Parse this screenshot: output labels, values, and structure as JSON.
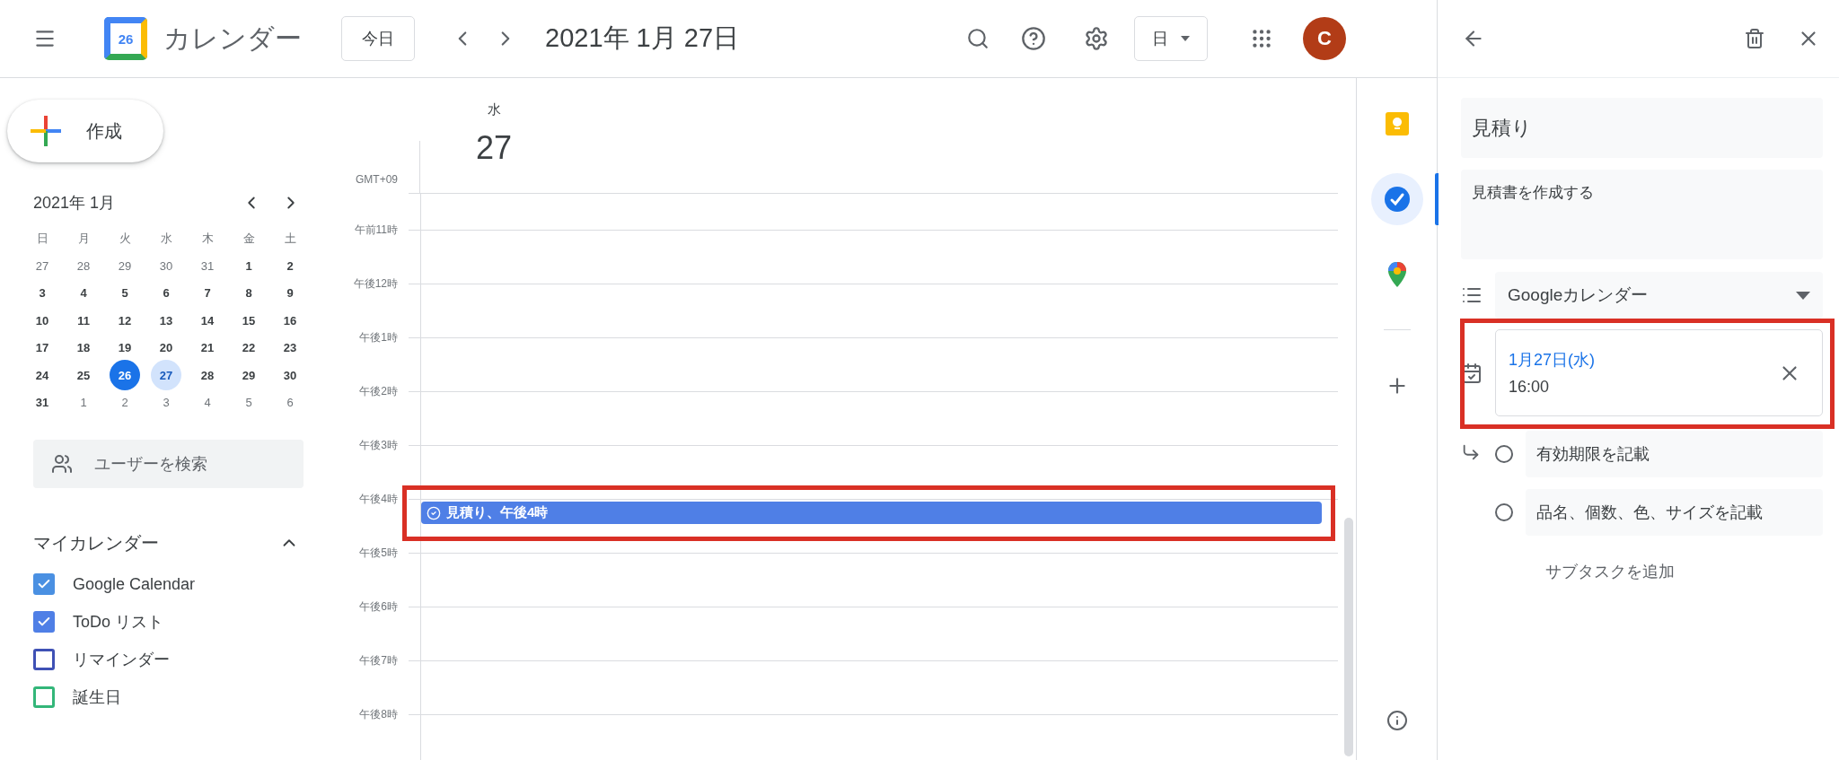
{
  "header": {
    "app_title": "カレンダー",
    "logo_day": "26",
    "today_button": "今日",
    "date_title": "2021年 1月 27日",
    "view_select": "日",
    "avatar": "C"
  },
  "create_button": "作成",
  "mini_calendar": {
    "title": "2021年 1月",
    "weekdays": [
      "日",
      "月",
      "火",
      "水",
      "木",
      "金",
      "土"
    ],
    "weeks": [
      [
        {
          "day": "27",
          "muted": true,
          "today": false,
          "selected": false
        },
        {
          "day": "28",
          "muted": true,
          "today": false,
          "selected": false
        },
        {
          "day": "29",
          "muted": true,
          "today": false,
          "selected": false
        },
        {
          "day": "30",
          "muted": true,
          "today": false,
          "selected": false
        },
        {
          "day": "31",
          "muted": true,
          "today": false,
          "selected": false
        },
        {
          "day": "1",
          "muted": false,
          "today": false,
          "selected": false
        },
        {
          "day": "2",
          "muted": false,
          "today": false,
          "selected": false
        }
      ],
      [
        {
          "day": "3",
          "muted": false,
          "today": false,
          "selected": false
        },
        {
          "day": "4",
          "muted": false,
          "today": false,
          "selected": false
        },
        {
          "day": "5",
          "muted": false,
          "today": false,
          "selected": false
        },
        {
          "day": "6",
          "muted": false,
          "today": false,
          "selected": false
        },
        {
          "day": "7",
          "muted": false,
          "today": false,
          "selected": false
        },
        {
          "day": "8",
          "muted": false,
          "today": false,
          "selected": false
        },
        {
          "day": "9",
          "muted": false,
          "today": false,
          "selected": false
        }
      ],
      [
        {
          "day": "10",
          "muted": false,
          "today": false,
          "selected": false
        },
        {
          "day": "11",
          "muted": false,
          "today": false,
          "selected": false
        },
        {
          "day": "12",
          "muted": false,
          "today": false,
          "selected": false
        },
        {
          "day": "13",
          "muted": false,
          "today": false,
          "selected": false
        },
        {
          "day": "14",
          "muted": false,
          "today": false,
          "selected": false
        },
        {
          "day": "15",
          "muted": false,
          "today": false,
          "selected": false
        },
        {
          "day": "16",
          "muted": false,
          "today": false,
          "selected": false
        }
      ],
      [
        {
          "day": "17",
          "muted": false,
          "today": false,
          "selected": false
        },
        {
          "day": "18",
          "muted": false,
          "today": false,
          "selected": false
        },
        {
          "day": "19",
          "muted": false,
          "today": false,
          "selected": false
        },
        {
          "day": "20",
          "muted": false,
          "today": false,
          "selected": false
        },
        {
          "day": "21",
          "muted": false,
          "today": false,
          "selected": false
        },
        {
          "day": "22",
          "muted": false,
          "today": false,
          "selected": false
        },
        {
          "day": "23",
          "muted": false,
          "today": false,
          "selected": false
        }
      ],
      [
        {
          "day": "24",
          "muted": false,
          "today": false,
          "selected": false
        },
        {
          "day": "25",
          "muted": false,
          "today": false,
          "selected": false
        },
        {
          "day": "26",
          "muted": false,
          "today": true,
          "selected": false
        },
        {
          "day": "27",
          "muted": false,
          "today": false,
          "selected": true
        },
        {
          "day": "28",
          "muted": false,
          "today": false,
          "selected": false
        },
        {
          "day": "29",
          "muted": false,
          "today": false,
          "selected": false
        },
        {
          "day": "30",
          "muted": false,
          "today": false,
          "selected": false
        }
      ],
      [
        {
          "day": "31",
          "muted": false,
          "today": false,
          "selected": false
        },
        {
          "day": "1",
          "muted": true,
          "today": false,
          "selected": false
        },
        {
          "day": "2",
          "muted": true,
          "today": false,
          "selected": false
        },
        {
          "day": "3",
          "muted": true,
          "today": false,
          "selected": false
        },
        {
          "day": "4",
          "muted": true,
          "today": false,
          "selected": false
        },
        {
          "day": "5",
          "muted": true,
          "today": false,
          "selected": false
        },
        {
          "day": "6",
          "muted": true,
          "today": false,
          "selected": false
        }
      ]
    ]
  },
  "user_search": {
    "placeholder": "ユーザーを検索"
  },
  "my_calendars": {
    "title": "マイカレンダー",
    "expanded": true,
    "items": [
      {
        "label": "Google Calendar",
        "checked": true,
        "color": "#4a90e2"
      },
      {
        "label": "ToDo リスト",
        "checked": true,
        "color": "#4f7fe6"
      },
      {
        "label": "リマインダー",
        "checked": false,
        "color": "#3f51b5"
      },
      {
        "label": "誕生日",
        "checked": false,
        "color": "#33b679"
      }
    ]
  },
  "day_view": {
    "weekday": "水",
    "day": "27",
    "timezone": "GMT+09",
    "hours": [
      {
        "label": "午前11時"
      },
      {
        "label": "午後12時"
      },
      {
        "label": "午後1時"
      },
      {
        "label": "午後2時"
      },
      {
        "label": "午後3時"
      },
      {
        "label": "午後4時",
        "events": [
          {
            "title": "見積り、午後4時",
            "kind": "task"
          }
        ]
      },
      {
        "label": "午後5時"
      },
      {
        "label": "午後6時"
      },
      {
        "label": "午後7時"
      },
      {
        "label": "午後8時"
      }
    ]
  },
  "side_rail": [
    {
      "kind": "keep",
      "selected": false
    },
    {
      "kind": "tasks",
      "selected": true
    },
    {
      "kind": "maps",
      "selected": false
    }
  ],
  "task_panel": {
    "title": "見積り",
    "details": "見積書を作成する",
    "list": "Googleカレンダー",
    "due": {
      "date": "1月27日(水)",
      "time": "16:00"
    },
    "subtasks": [
      {
        "title": "有効期限を記載",
        "done": false
      },
      {
        "title": "品名、個数、色、サイズを記載",
        "done": false
      }
    ],
    "add_subtask": "サブタスクを追加"
  }
}
